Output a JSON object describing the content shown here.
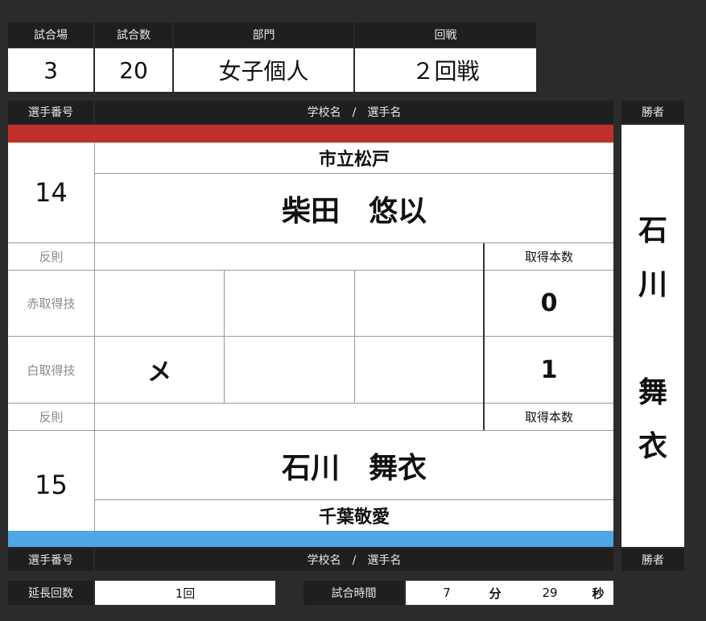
{
  "top": {
    "venue_label": "試合場",
    "venue_value": "3",
    "match_label": "試合数",
    "match_value": "20",
    "division_label": "部門",
    "division_value": "女子個人",
    "round_label": "回戦",
    "round_value": "２回戦"
  },
  "header": {
    "player_no": "選手番号",
    "school_player": "学校名　/　選手名",
    "winner": "勝者"
  },
  "red": {
    "number": "14",
    "school": "市立松戸",
    "name": "柴田　悠以",
    "foul_label": "反則",
    "points_label": "取得本数",
    "score": "0",
    "techniques_label": "赤取得技",
    "techniques": [
      "",
      "",
      ""
    ],
    "color": "#c0302a"
  },
  "white": {
    "number": "15",
    "school": "千葉敬愛",
    "name": "石川　舞衣",
    "foul_label": "反則",
    "points_label": "取得本数",
    "score": "1",
    "techniques_label": "白取得技",
    "techniques": [
      "メ",
      "",
      ""
    ],
    "color": "#4ea6e6"
  },
  "winner": {
    "chars": [
      "石",
      "川",
      "",
      "舞",
      "衣"
    ]
  },
  "footer": {
    "extension_label": "延長回数",
    "extension_value": "1回",
    "time_label": "試合時間",
    "minutes": "7",
    "min_unit": "分",
    "seconds": "29",
    "sec_unit": "秒"
  }
}
